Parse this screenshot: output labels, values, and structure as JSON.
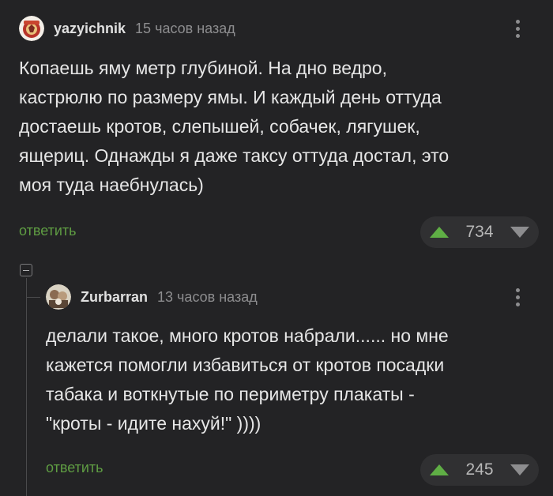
{
  "colors": {
    "background": "#232325",
    "reply_link": "#5f9d43",
    "upvote": "#5fae45"
  },
  "comments": [
    {
      "username": "yazyichnik",
      "timestamp": "15 часов назад",
      "avatar_icon": "red-emblem-avatar",
      "lines": [
        "Копаешь яму метр глубиной. На дно ведро,",
        "кастрюлю по размеру ямы. И каждый день оттуда",
        "достаешь кротов, слепышей, собачек, лягушек,",
        "ящериц. Однажды я даже таксу оттуда достал, это",
        "моя туда наебнулась)"
      ],
      "reply_label": "ответить",
      "score": "734"
    },
    {
      "username": "Zurbarran",
      "timestamp": "13 часов назад",
      "avatar_icon": "painting-portrait-avatar",
      "lines": [
        "делали такое, много кротов набрали...... но мне",
        "кажется помогли избавиться от кротов посадки",
        "табака и воткнутые по периметру плакаты -",
        "\"кроты - идите нахуй!\" ))))"
      ],
      "reply_label": "ответить",
      "score": "245"
    }
  ]
}
